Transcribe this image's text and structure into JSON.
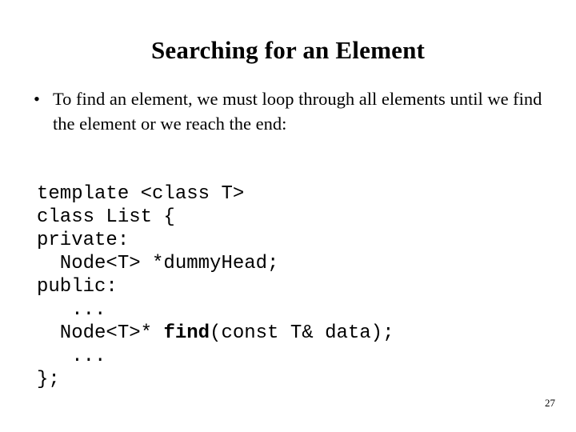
{
  "slide": {
    "title": "Searching for an Element",
    "page_number": "27",
    "background_color": "#ffffff",
    "text_color": "#000000"
  },
  "body": {
    "bullets": [
      {
        "marker": "•",
        "text": "To find an element, we must loop through all elements until we find the element or we reach the end:"
      }
    ]
  },
  "code": {
    "lines": [
      {
        "segments": [
          {
            "text": "template <class T>",
            "bold": false
          }
        ]
      },
      {
        "segments": [
          {
            "text": "class List {",
            "bold": false
          }
        ]
      },
      {
        "segments": [
          {
            "text": "private:",
            "bold": false
          }
        ]
      },
      {
        "segments": [
          {
            "text": "  Node<T> *dummyHead;",
            "bold": false
          }
        ]
      },
      {
        "segments": [
          {
            "text": "public:",
            "bold": false
          }
        ]
      },
      {
        "segments": [
          {
            "text": "   ...",
            "bold": false
          }
        ]
      },
      {
        "segments": [
          {
            "text": "  Node<T>* ",
            "bold": false
          },
          {
            "text": "find",
            "bold": true
          },
          {
            "text": "(const T& data);",
            "bold": false
          }
        ]
      },
      {
        "segments": [
          {
            "text": "   ...",
            "bold": false
          }
        ]
      },
      {
        "segments": [
          {
            "text": "};",
            "bold": false
          }
        ]
      }
    ]
  }
}
